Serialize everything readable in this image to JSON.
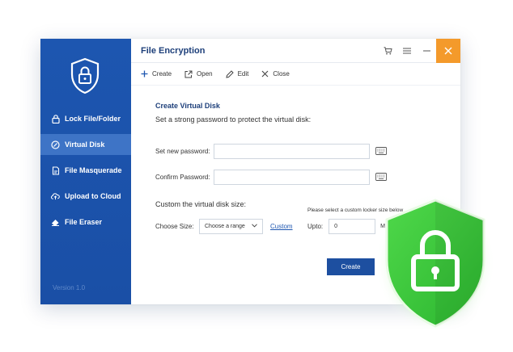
{
  "sidebar": {
    "items": [
      {
        "label": "Lock File/Folder",
        "icon": "lock-icon"
      },
      {
        "label": "Virtual Disk",
        "icon": "disk-icon"
      },
      {
        "label": "File Masquerade",
        "icon": "masquerade-icon"
      },
      {
        "label": "Upload to Cloud",
        "icon": "cloud-upload-icon"
      },
      {
        "label": "File Eraser",
        "icon": "eraser-icon"
      }
    ],
    "active_index": 1,
    "version": "Version 1.0"
  },
  "header": {
    "title": "File Encryption"
  },
  "toolbar": {
    "create_label": "Create",
    "open_label": "Open",
    "edit_label": "Edit",
    "close_label": "Close"
  },
  "form": {
    "heading": "Create Virtual Disk",
    "subheading": "Set a strong password to protect the virtual disk:",
    "new_password_label": "Set new password:",
    "confirm_password_label": "Confirm Password:",
    "size_heading": "Custom the virtual disk size:",
    "choose_size_label": "Choose Size:",
    "size_select_value": "Choose a range",
    "custom_link": "Custom",
    "custom_hint": "Please select a custom locker size below",
    "upto_label": "Upto:",
    "upto_value": "0",
    "upto_unit": "M",
    "create_button": "Create"
  },
  "colors": {
    "sidebar": "#1d56b0",
    "active_item": "#3e74c6",
    "close_button": "#f49a2b",
    "shield_green": "#3cc83c",
    "title_text": "#1d3f7a"
  }
}
